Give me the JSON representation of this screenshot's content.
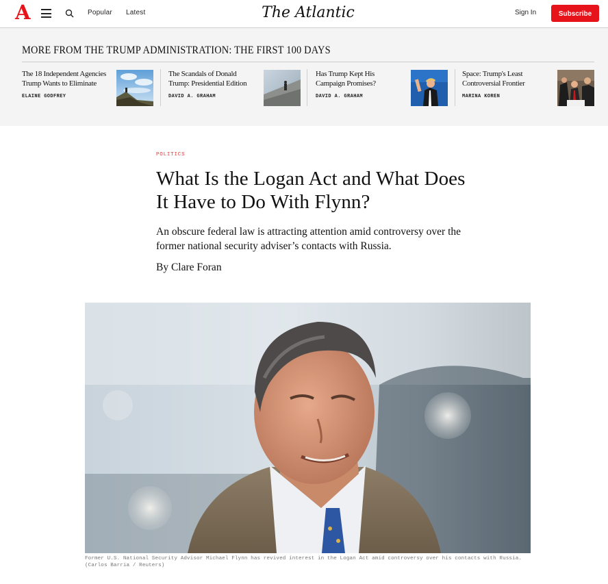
{
  "header": {
    "logo_letter": "A",
    "nav": {
      "popular": "Popular",
      "latest": "Latest"
    },
    "masthead": "The Atlantic",
    "sign_in": "Sign In",
    "subscribe": "Subscribe",
    "accent_color": "#e7131a"
  },
  "related": {
    "title": "MORE FROM THE TRUMP ADMINISTRATION: THE FIRST 100 DAYS",
    "items": [
      {
        "headline": "The 18 Independent Agencies Trump Wants to Eliminate",
        "author": "ELAINE GODFREY",
        "thumb": "hiker-on-mountain-photo"
      },
      {
        "headline": "The Scandals of Donald Trump: Presidential Edition",
        "author": "DAVID A. GRAHAM",
        "thumb": "person-on-rooftop-photo"
      },
      {
        "headline": "Has Trump Kept His Campaign Promises?",
        "author": "DAVID A. GRAHAM",
        "thumb": "trump-waving-photo"
      },
      {
        "headline": "Space: Trump's Least Controversial Frontier",
        "author": "MARINA KOREN",
        "thumb": "trump-signing-order-photo"
      }
    ]
  },
  "article": {
    "kicker": "POLITICS",
    "headline": "What Is the Logan Act and What Does It Have to Do With Flynn?",
    "dek": "An obscure federal law is attracting attention amid controversy over the former national security adviser’s contacts with Russia.",
    "byline": "By Clare Foran",
    "hero_image": "michael-flynn-portrait-photo",
    "caption": "Former U.S. National Security Advisor Michael Flynn has revived interest in the Logan Act amid controversy over his contacts with Russia. (Carlos Barria / Reuters)"
  }
}
